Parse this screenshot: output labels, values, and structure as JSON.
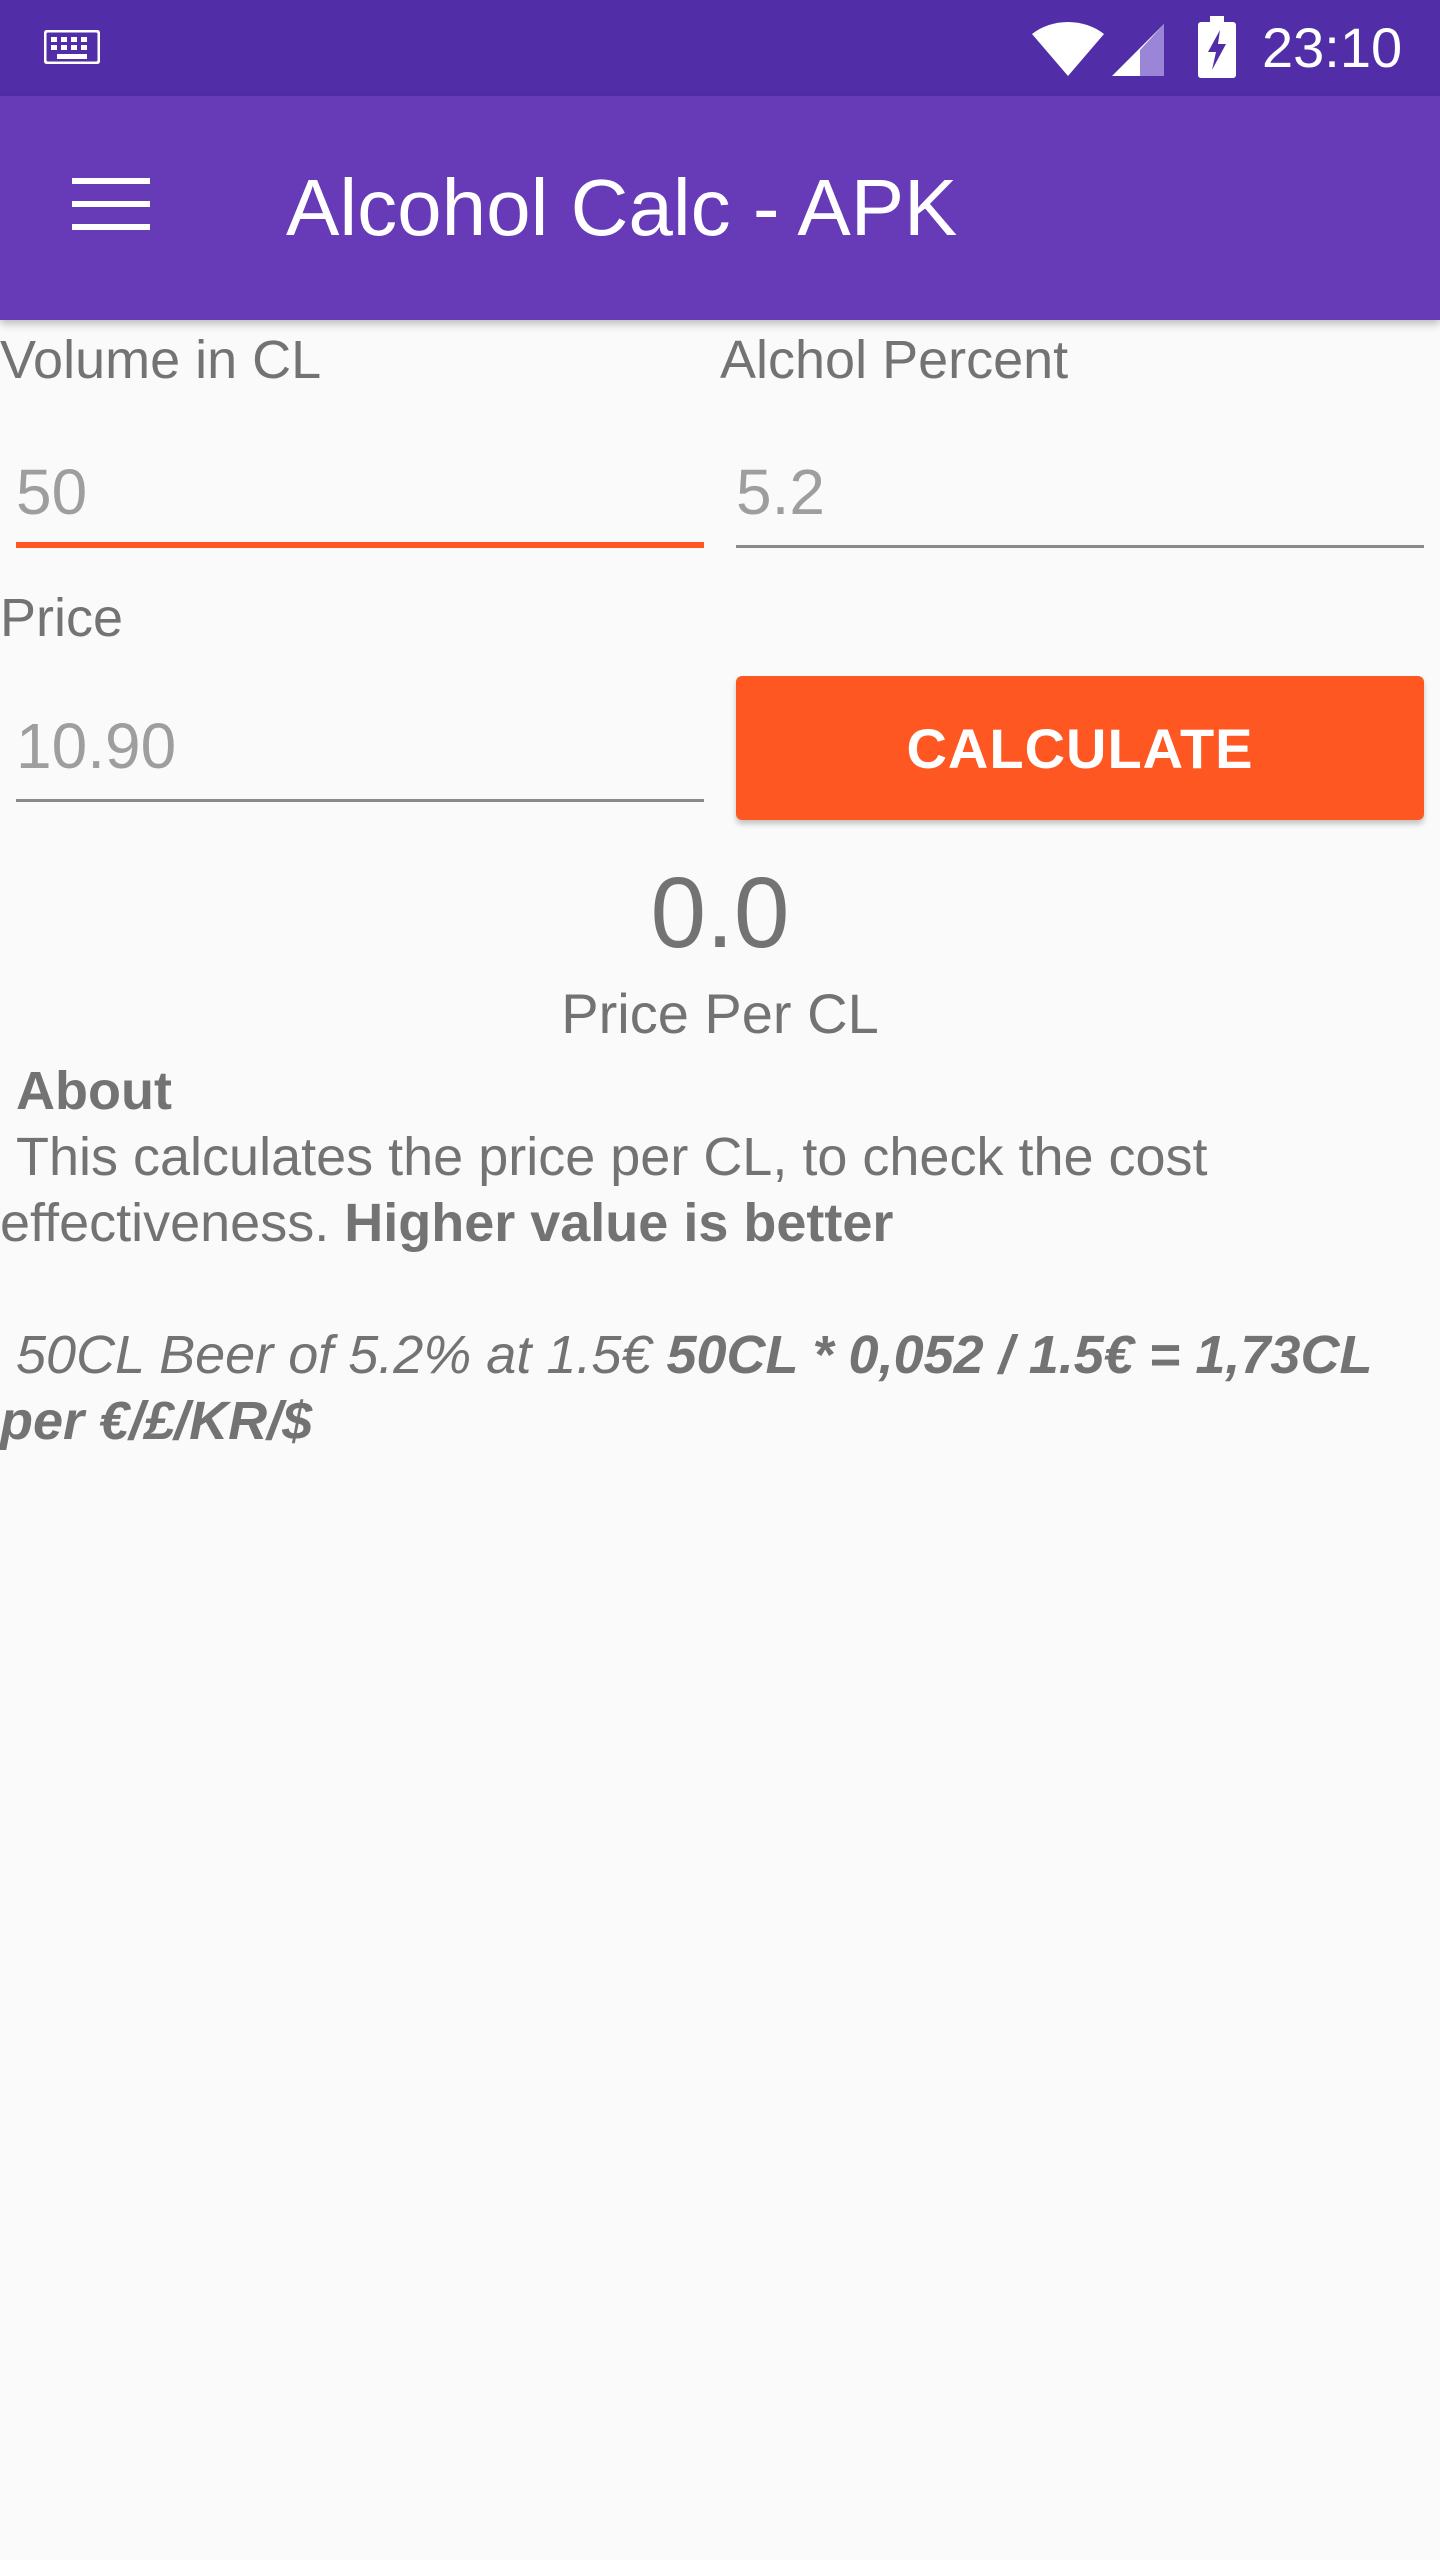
{
  "status_bar": {
    "time": "23:10",
    "icons": [
      "keyboard-icon",
      "wifi-icon",
      "signal-icon",
      "battery-charging-icon"
    ]
  },
  "app_bar": {
    "title": "Alcohol Calc - APK",
    "menu_icon": "menu-icon"
  },
  "form": {
    "volume": {
      "label": "Volume in CL",
      "placeholder": "50"
    },
    "percent": {
      "label": "Alchol Percent",
      "placeholder": "5.2"
    },
    "price": {
      "label": "Price",
      "placeholder": "10.90"
    },
    "calculate_label": "CALCULATE"
  },
  "result": {
    "value": "0.0",
    "label": "Price Per CL"
  },
  "about": {
    "title": "About",
    "body": "This calculates the price per CL, to check the cost effectiveness.",
    "body_bold": "Higher value is better",
    "example": "50CL Beer of 5.2% at 1.5€",
    "example_bold": "50CL * 0,052 / 1.5€ = 1,73CL per €/£/KR/$"
  },
  "colors": {
    "status_bar": "#512da8",
    "app_bar": "#673ab7",
    "accent": "#ff5722",
    "background": "#fafafa",
    "text": "#737373"
  }
}
